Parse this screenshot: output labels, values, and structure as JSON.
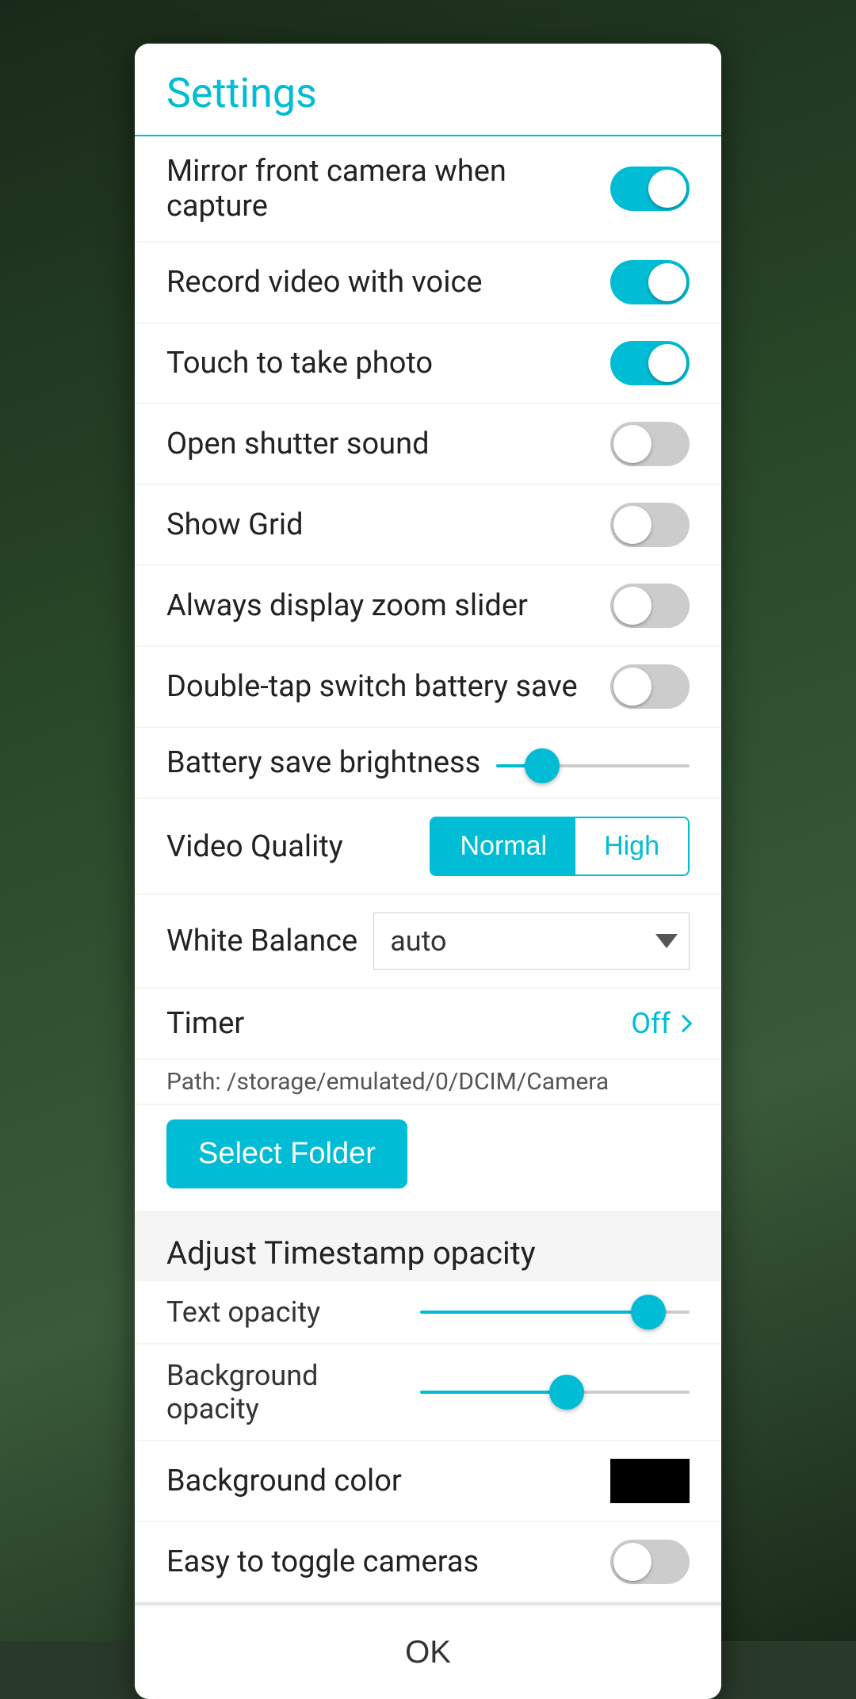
{
  "dialog": {
    "title": "Settings"
  },
  "settings": {
    "mirror_front_camera": {
      "label": "Mirror front camera when capture",
      "enabled": true
    },
    "record_video_voice": {
      "label": "Record video with voice",
      "enabled": true
    },
    "touch_to_take_photo": {
      "label": "Touch to take photo",
      "enabled": true
    },
    "open_shutter_sound": {
      "label": "Open shutter sound",
      "enabled": false
    },
    "show_grid": {
      "label": "Show Grid",
      "enabled": false
    },
    "always_display_zoom": {
      "label": "Always display zoom slider",
      "enabled": false
    },
    "double_tap_battery": {
      "label": "Double-tap switch battery save",
      "enabled": false
    },
    "battery_brightness": {
      "label": "Battery save brightness"
    },
    "video_quality": {
      "label": "Video Quality",
      "normal_label": "Normal",
      "high_label": "High",
      "selected": "normal"
    },
    "white_balance": {
      "label": "White Balance",
      "value": "auto"
    },
    "timer": {
      "label": "Timer",
      "value": "Off"
    },
    "path": {
      "label": "Path: /storage/emulated/0/DCIM/Camera"
    },
    "select_folder": {
      "label": "Select Folder"
    },
    "timestamp_section": {
      "label": "Adjust Timestamp opacity"
    },
    "text_opacity": {
      "label": "Text opacity"
    },
    "background_opacity": {
      "label": "Background opacity"
    },
    "background_color": {
      "label": "Background color"
    },
    "easy_toggle": {
      "label": "Easy to toggle cameras",
      "enabled": false
    }
  },
  "footer": {
    "ok_label": "OK"
  }
}
